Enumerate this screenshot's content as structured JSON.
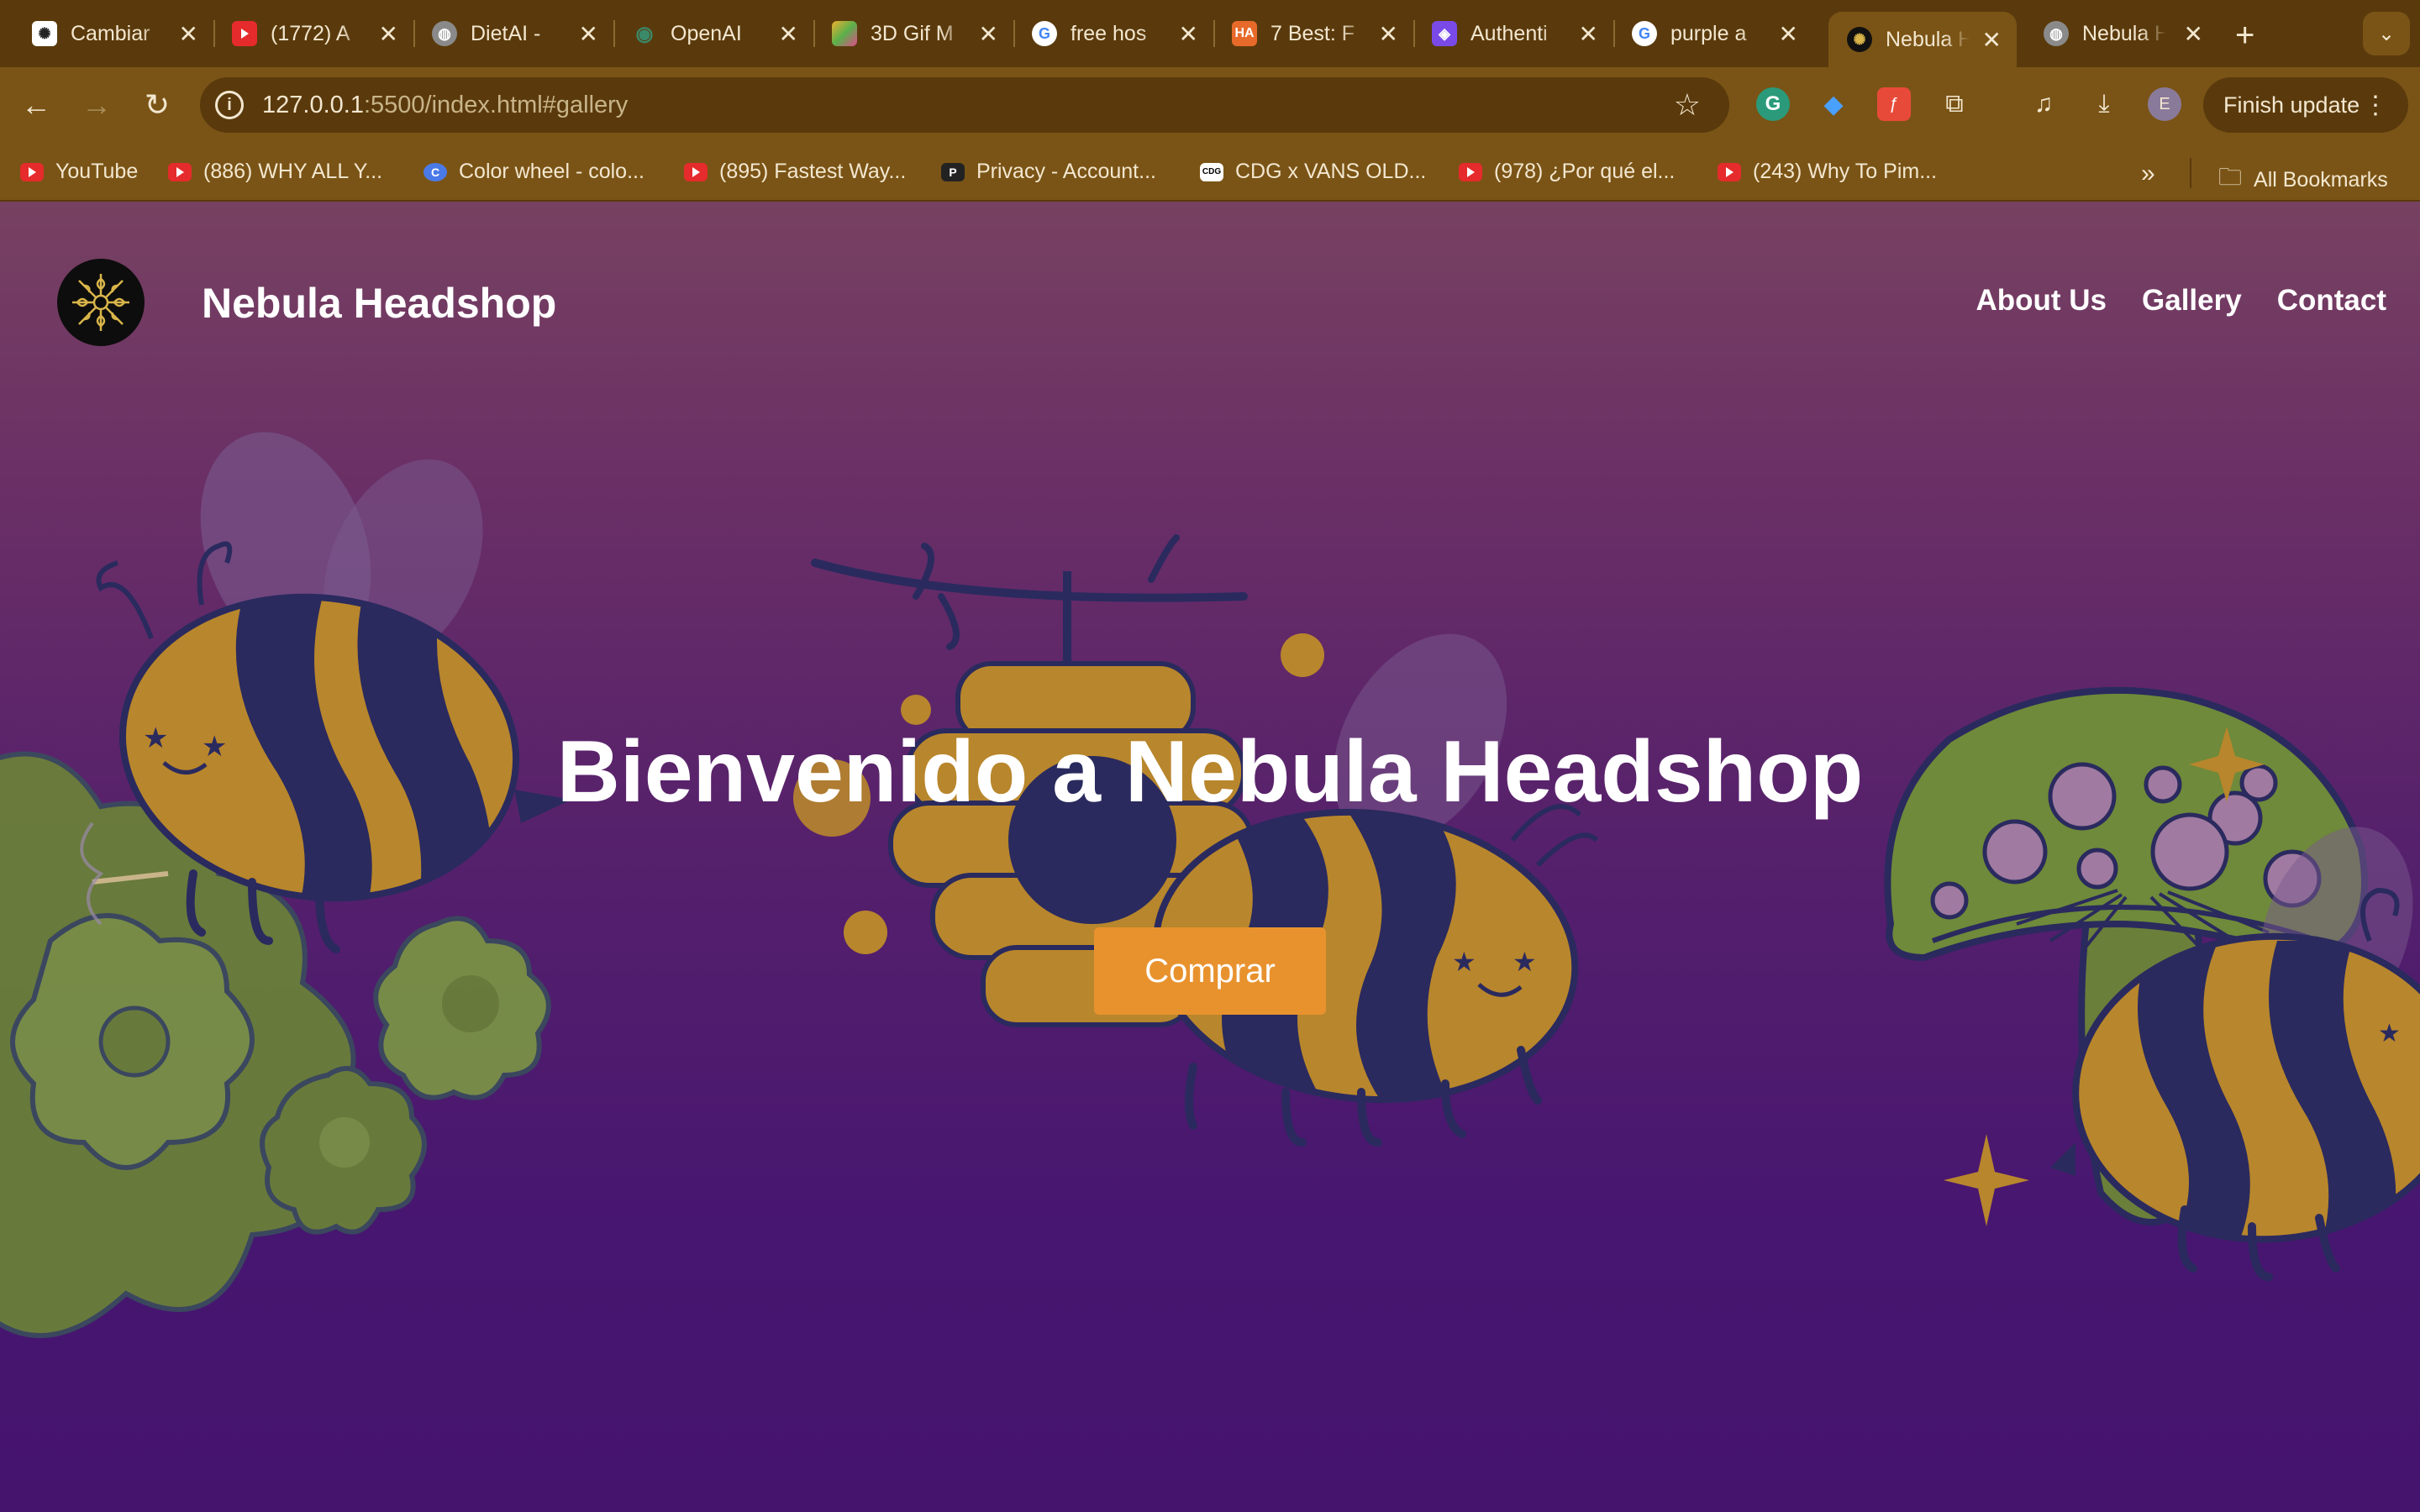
{
  "browser": {
    "tabs": [
      {
        "title": "Cambiar",
        "favicon": "openai-icon",
        "color": "#ffffff"
      },
      {
        "title": "(1772) A",
        "favicon": "youtube-icon",
        "color": "#e52b2b"
      },
      {
        "title": "DietAI -",
        "favicon": "globe-icon",
        "color": "#c9c9c9"
      },
      {
        "title": "OpenAI",
        "favicon": "openai-eye-icon",
        "color": "#3a8a6a"
      },
      {
        "title": "3D Gif M",
        "favicon": "gif-maker-icon",
        "color": "#f0b030"
      },
      {
        "title": "free hos",
        "favicon": "google-icon",
        "color": "#ffffff"
      },
      {
        "title": "7 Best: F",
        "favicon": "ha-icon",
        "color": "#e86a2a"
      },
      {
        "title": "Authenti",
        "favicon": "auth-icon",
        "color": "#7a4ae8"
      },
      {
        "title": "purple a",
        "favicon": "google-icon",
        "color": "#ffffff"
      },
      {
        "title": "Nebula H",
        "favicon": "nebula-logo-icon",
        "color": "#111111"
      },
      {
        "title": "Nebula H",
        "favicon": "globe-icon",
        "color": "#c9c9c9"
      }
    ],
    "active_tab_index": 9,
    "address": {
      "host": "127.0.0.1",
      "rest": ":5500/index.html#gallery"
    },
    "finish_update_label": "Finish update",
    "profile_initial": "E",
    "bookmarks": [
      {
        "label": "YouTube",
        "icon": "youtube-icon"
      },
      {
        "label": "(886) WHY ALL Y...",
        "icon": "youtube-icon"
      },
      {
        "label": "Color wheel - colo...",
        "icon": "canva-icon"
      },
      {
        "label": "(895) Fastest Way...",
        "icon": "youtube-icon"
      },
      {
        "label": "Privacy - Account...",
        "icon": "p-icon"
      },
      {
        "label": "CDG x VANS OLD...",
        "icon": "cdg-icon"
      },
      {
        "label": "(978) ¿Por qué el...",
        "icon": "youtube-icon"
      },
      {
        "label": "(243) Why To Pim...",
        "icon": "youtube-icon"
      }
    ],
    "all_bookmarks_label": "All Bookmarks"
  },
  "site": {
    "brand": "Nebula Headshop",
    "nav": [
      "About Us",
      "Gallery",
      "Contact"
    ],
    "hero_title": "Bienvenido a Nebula Headshop",
    "cta_label": "Comprar"
  },
  "colors": {
    "accent": "#e8922e",
    "bee_yellow": "#b8862c",
    "bee_navy": "#2a2a5e",
    "mushroom_green": "#6e8a3a",
    "page_top": "#774161",
    "page_bottom": "#45146d"
  }
}
